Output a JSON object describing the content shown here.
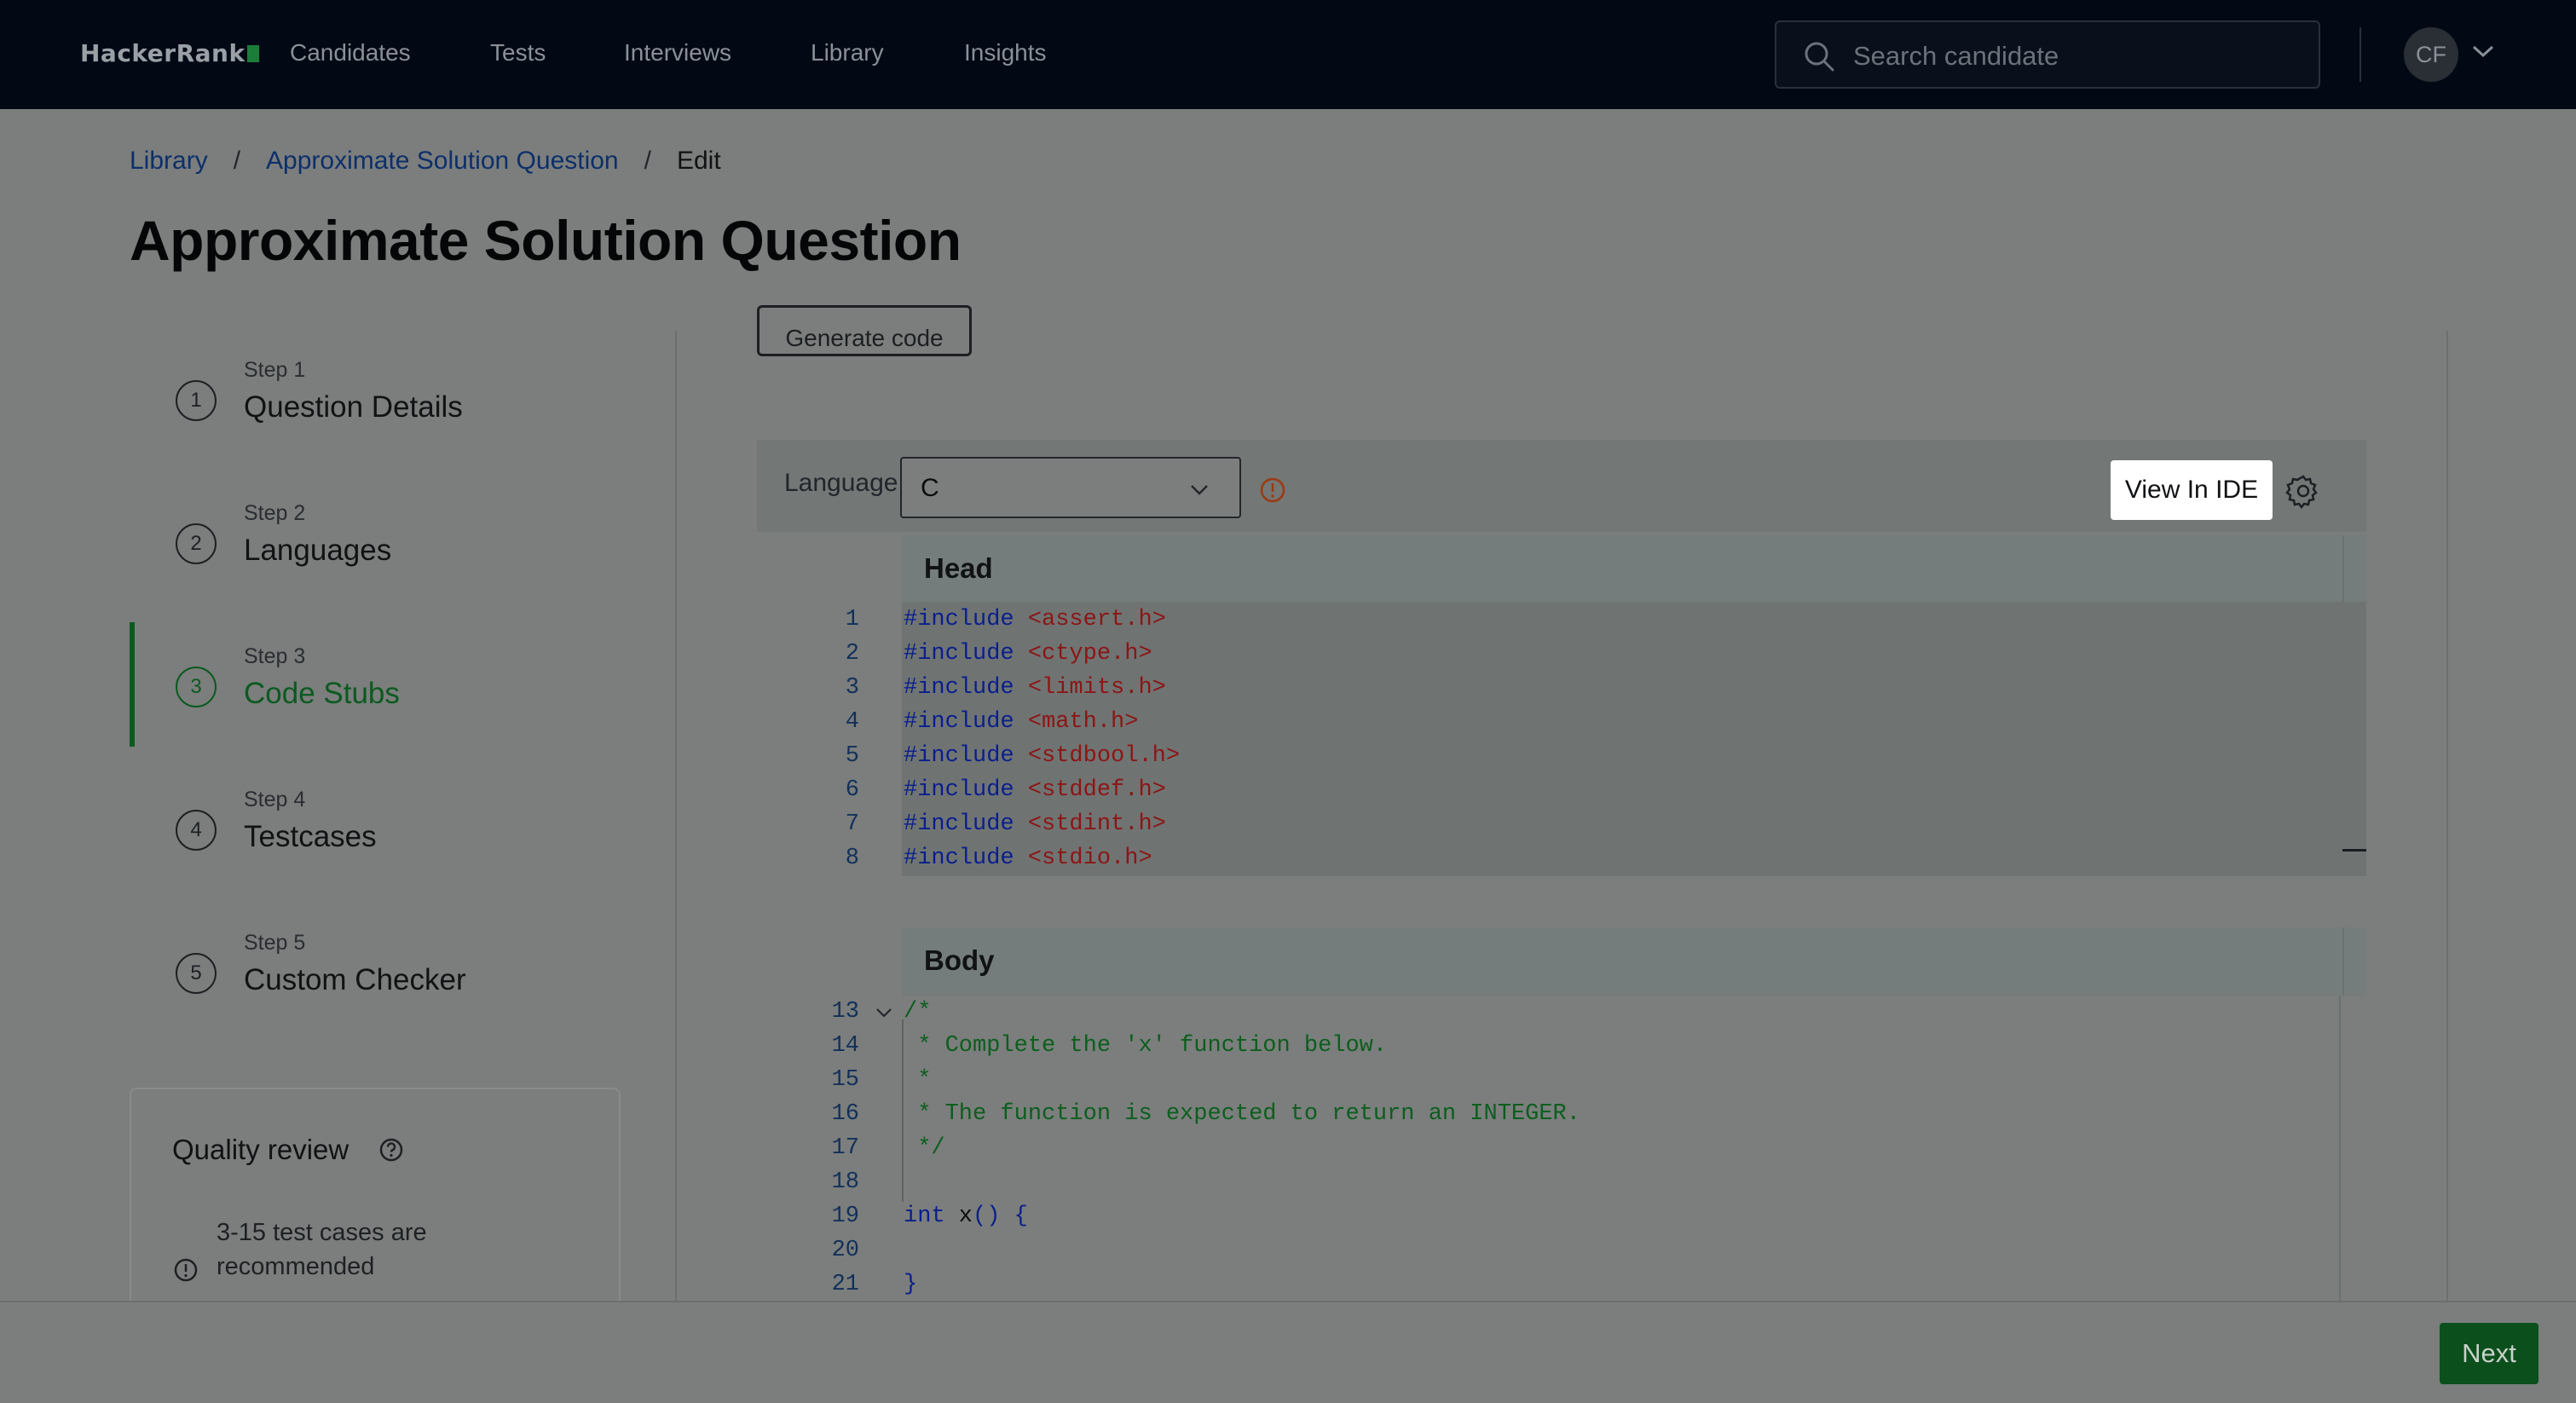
{
  "app": {
    "logo": "HackerRank"
  },
  "nav": {
    "links": [
      "Candidates",
      "Tests",
      "Interviews",
      "Library",
      "Insights"
    ],
    "search_placeholder": "Search candidate",
    "avatar_initials": "CF"
  },
  "breadcrumb": {
    "items": [
      "Library",
      "Approximate Solution Question",
      "Edit"
    ],
    "separator": "/"
  },
  "page": {
    "title": "Approximate Solution Question"
  },
  "steps": [
    {
      "num": "1",
      "label": "Step 1",
      "title": "Question Details",
      "active": false
    },
    {
      "num": "2",
      "label": "Step 2",
      "title": "Languages",
      "active": false
    },
    {
      "num": "3",
      "label": "Step 3",
      "title": "Code Stubs",
      "active": true
    },
    {
      "num": "4",
      "label": "Step 4",
      "title": "Testcases",
      "active": false
    },
    {
      "num": "5",
      "label": "Step 5",
      "title": "Custom Checker",
      "active": false
    }
  ],
  "quality_review": {
    "title": "Quality review",
    "message": "3-15 test cases are recommended"
  },
  "editor": {
    "generate_button": "Generate code",
    "language_label": "Language",
    "language_value": "C",
    "view_ide_button": "View In IDE",
    "head_title": "Head",
    "body_title": "Body",
    "head_lines": [
      {
        "n": "1",
        "kw": "#include",
        "val": "<assert.h>"
      },
      {
        "n": "2",
        "kw": "#include",
        "val": "<ctype.h>"
      },
      {
        "n": "3",
        "kw": "#include",
        "val": "<limits.h>"
      },
      {
        "n": "4",
        "kw": "#include",
        "val": "<math.h>"
      },
      {
        "n": "5",
        "kw": "#include",
        "val": "<stdbool.h>"
      },
      {
        "n": "6",
        "kw": "#include",
        "val": "<stddef.h>"
      },
      {
        "n": "7",
        "kw": "#include",
        "val": "<stdint.h>"
      },
      {
        "n": "8",
        "kw": "#include",
        "val": "<stdio.h>"
      }
    ],
    "body_lines": [
      {
        "n": "13",
        "text": "/*"
      },
      {
        "n": "14",
        "text": " * Complete the 'x' function below."
      },
      {
        "n": "15",
        "text": " *"
      },
      {
        "n": "16",
        "text": " * The function is expected to return an INTEGER."
      },
      {
        "n": "17",
        "text": " */"
      },
      {
        "n": "18",
        "text": ""
      },
      {
        "n": "19",
        "kw": "int",
        "name": " x",
        "rest": "() {"
      },
      {
        "n": "20",
        "text": ""
      },
      {
        "n": "21",
        "text": "}"
      }
    ]
  },
  "footer": {
    "next_button": "Next"
  },
  "colors": {
    "brand_green": "#0b4f1c",
    "link_blue": "#0d2f6b",
    "nav_bg": "#030914"
  }
}
